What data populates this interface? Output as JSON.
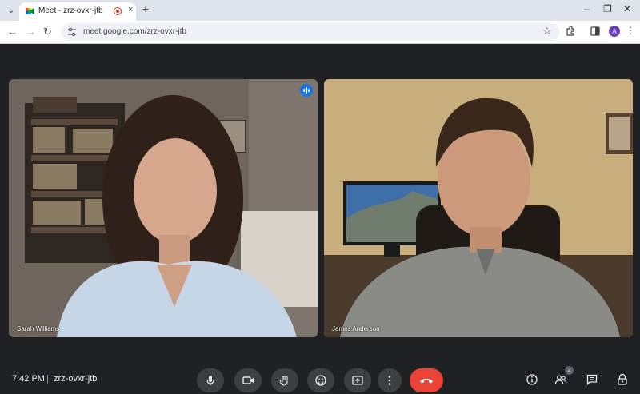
{
  "browser": {
    "tab_title": "Meet - zrz-ovxr-jtb",
    "url": "meet.google.com/zrz-ovxr-jtb",
    "profile_initial": "A",
    "new_tab_glyph": "+",
    "close_glyph": "×"
  },
  "participants": [
    {
      "name": "Sarah Williams",
      "speaking": true
    },
    {
      "name": "James Anderson",
      "speaking": false
    }
  ],
  "meeting": {
    "time": "7:42 PM",
    "separator": "|",
    "code": "zrz-ovxr-jtb",
    "people_count": "2"
  },
  "controls": [
    "microphone-icon",
    "camera-icon",
    "raise-hand-icon",
    "emoji-icon",
    "present-screen-icon",
    "more-options-icon",
    "end-call-icon"
  ],
  "right_controls": [
    "info-icon",
    "people-icon",
    "chat-icon",
    "host-controls-icon"
  ],
  "colors": {
    "background": "#202124",
    "end_call": "#ea4335",
    "control": "#3c4043",
    "speaking": "#1a73e8"
  }
}
